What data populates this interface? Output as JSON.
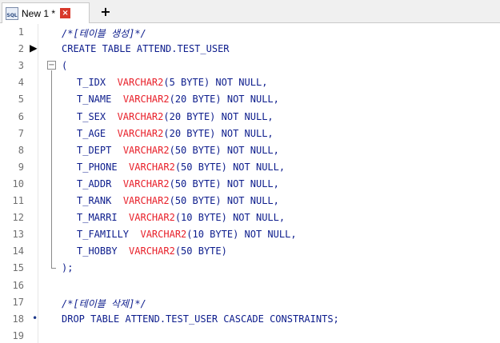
{
  "tab": {
    "title": "New 1 *",
    "icon_text": "SQL"
  },
  "lines": [
    {
      "n": "1",
      "text": "/*[테이블 생성]*/",
      "kind": "comment"
    },
    {
      "n": "2",
      "text": "CREATE TABLE ATTEND.TEST_USER",
      "kind": "plain"
    },
    {
      "n": "3",
      "text": "(",
      "kind": "plain"
    },
    {
      "n": "4",
      "col": "T_IDX",
      "type": "VARCHAR2",
      "rest": "(5 BYTE) NOT NULL,"
    },
    {
      "n": "5",
      "col": "T_NAME",
      "type": "VARCHAR2",
      "rest": "(20 BYTE) NOT NULL,"
    },
    {
      "n": "6",
      "col": "T_SEX",
      "type": "VARCHAR2",
      "rest": "(20 BYTE) NOT NULL,"
    },
    {
      "n": "7",
      "col": "T_AGE",
      "type": "VARCHAR2",
      "rest": "(20 BYTE) NOT NULL,"
    },
    {
      "n": "8",
      "col": "T_DEPT",
      "type": "VARCHAR2",
      "rest": "(50 BYTE) NOT NULL,"
    },
    {
      "n": "9",
      "col": "T_PHONE",
      "type": "VARCHAR2",
      "rest": "(50 BYTE) NOT NULL,"
    },
    {
      "n": "10",
      "col": "T_ADDR",
      "type": "VARCHAR2",
      "rest": "(50 BYTE) NOT NULL,"
    },
    {
      "n": "11",
      "col": "T_RANK",
      "type": "VARCHAR2",
      "rest": "(50 BYTE) NOT NULL,"
    },
    {
      "n": "12",
      "col": "T_MARRI",
      "type": "VARCHAR2",
      "rest": "(10 BYTE) NOT NULL,"
    },
    {
      "n": "13",
      "col": "T_FAMILLY",
      "type": "VARCHAR2",
      "rest": "(10 BYTE) NOT NULL,"
    },
    {
      "n": "14",
      "col": "T_HOBBY",
      "type": "VARCHAR2",
      "rest": "(50 BYTE)"
    },
    {
      "n": "15",
      "text": ");",
      "kind": "plain"
    },
    {
      "n": "16",
      "text": "",
      "kind": "plain"
    },
    {
      "n": "17",
      "text": "/*[테이블 삭제]*/",
      "kind": "comment"
    },
    {
      "n": "18",
      "text": "DROP TABLE ATTEND.TEST_USER CASCADE CONSTRAINTS;",
      "kind": "plain"
    },
    {
      "n": "19",
      "text": "",
      "kind": "plain"
    }
  ],
  "markers": {
    "arrow_line": "2",
    "bullet_line": "18"
  },
  "colors": {
    "keyword": "#0c1c8c",
    "type": "#e8202a",
    "line_number": "#6f6f6f"
  }
}
